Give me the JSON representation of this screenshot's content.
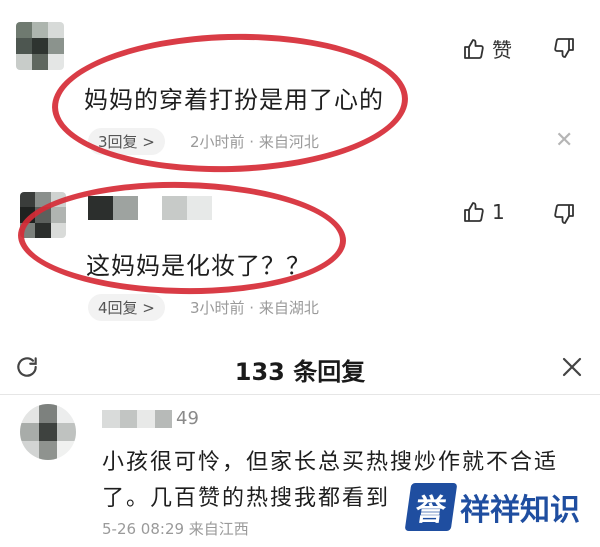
{
  "comments": [
    {
      "text": "妈妈的穿着打扮是用了心的",
      "like_label": "赞",
      "reply_pill": "3回复 >",
      "meta": "2小时前 · 来自河北"
    },
    {
      "text": "这妈妈是化妆了？？",
      "like_count": "1",
      "reply_pill": "4回复 >",
      "meta": "3小时前 · 来自湖北"
    }
  ],
  "reply_panel": {
    "title": "133 条回复",
    "reply": {
      "username_suffix": "49",
      "text_line1": "小孩很可怜，但家长总买热搜炒作就不合适",
      "text_line2": "了。几百赞的热搜我都看到",
      "meta": "5-26 08:29 来自江西"
    }
  },
  "watermark": {
    "box": "誉",
    "text": "祥祥知识"
  },
  "colors": {
    "annotation_red": "#d62b36",
    "watermark_blue": "#1f4ea0"
  }
}
